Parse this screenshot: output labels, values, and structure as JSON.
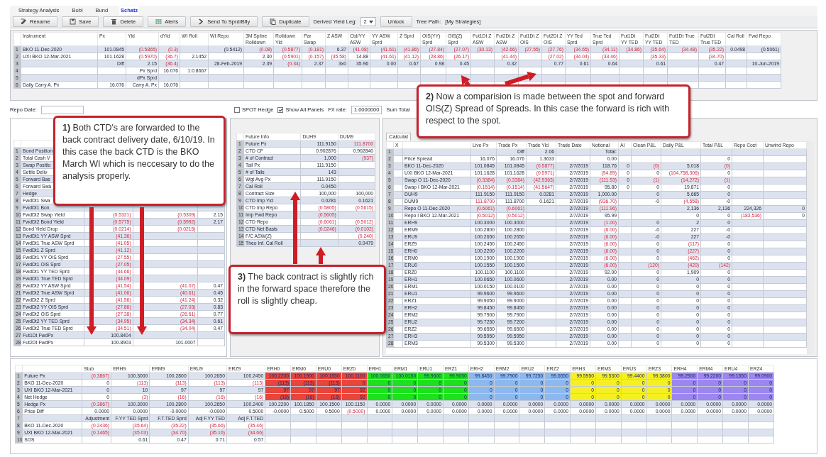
{
  "tabs": [
    {
      "label": "Strategy Analysis",
      "selected": false
    },
    {
      "label": "Bobl",
      "selected": false
    },
    {
      "label": "Bund",
      "selected": false
    },
    {
      "label": "Schatz",
      "selected": true
    }
  ],
  "toolbar": {
    "buttons": [
      "Rename",
      "Save",
      "Delete",
      "Alerts",
      "Send To Sprd/Bfly",
      "Duplicate"
    ],
    "derived_yield_leg": {
      "label": "Derived Yield Leg:",
      "value": "2"
    },
    "unlock": "Unlock",
    "tree_path": {
      "label": "Tree Path:",
      "value": "[My Strategies]"
    }
  },
  "top_table": {
    "columns": [
      "Instrument",
      "Px",
      "Yld",
      "dYld",
      "WI Roll",
      "WI Repo",
      "3M Spline Rolldown",
      "Rolldown Yld",
      "Par Swap",
      "Z ASW",
      "Ctd/YY ASW",
      "YY ASW Sprd",
      "Z Sprd",
      "OIS(YY) Sprd",
      "OIS(Z) Sprd",
      "Fut1Dt Z ASW",
      "Fut2Dt Z ASW",
      "Fut1Dt Z OIS",
      "Fut2Dt Z OIS",
      "YY Ted Sprd",
      "True Ted Sprd",
      "Fut1Dt YY TED",
      "Fut2Dt YY TED",
      "Fut1Dt True TED",
      "Fut2Dt True TED",
      "Cal Roll",
      "Fwd Repo"
    ],
    "rows": [
      {
        "n": "1",
        "cells": [
          {
            "text": "BKO 11-Dec-2020",
            "kind": "cyan"
          },
          {
            "text": "101.0845",
            "kind": "cyan"
          },
          {
            "text": "(0.5865)",
            "kind": "neg"
          },
          {
            "text": "(0.3)",
            "kind": "neg"
          },
          null,
          {
            "text": "(0.5412)",
            "kind": "cyan"
          },
          {
            "text": "(0.08)",
            "kind": "neg"
          },
          {
            "text": "(0.5877)",
            "kind": "neg"
          },
          {
            "text": "(0.181)",
            "kind": "neg"
          },
          "6.37",
          {
            "text": "(41.08)",
            "kind": "neg"
          },
          {
            "text": "(41.61)",
            "kind": "neg"
          },
          {
            "text": "(41.86)",
            "kind": "neg"
          },
          {
            "text": "(27.84)",
            "kind": "neg"
          },
          {
            "text": "(27.07)",
            "kind": "neg"
          },
          {
            "text": "(30.13)",
            "kind": "neg"
          },
          {
            "text": "(42.66)",
            "kind": "neg"
          },
          {
            "text": "(27.55)",
            "kind": "neg"
          },
          {
            "text": "(27.76)",
            "kind": "neg"
          },
          {
            "text": "(34.65)",
            "kind": "neg"
          },
          {
            "text": "(34.11)",
            "kind": "neg"
          },
          {
            "text": "(34.86)",
            "kind": "neg"
          },
          {
            "text": "(35.64)",
            "kind": "neg"
          },
          {
            "text": "(34.48)",
            "kind": "neg"
          },
          {
            "text": "(35.22)",
            "kind": "neg"
          },
          {
            "text": "0.0498",
            "kind": "cyan"
          },
          {
            "text": "(0.5061)",
            "kind": "cyan"
          }
        ]
      },
      {
        "n": "2",
        "cells": [
          {
            "text": "UXI BKO 12-Mar-2021",
            "kind": "cyan"
          },
          {
            "text": "101.1628",
            "kind": "cyan"
          },
          {
            "text": "(0.5970)",
            "kind": "neg"
          },
          {
            "text": "(36.7)",
            "kind": "neg"
          },
          {
            "text": "2.1452",
            "kind": "cyan"
          },
          null,
          "2.30",
          {
            "text": "(0.5901)",
            "kind": "neg"
          },
          {
            "text": "(0.157)",
            "kind": "neg"
          },
          {
            "text": "(35.58)",
            "kind": "neg"
          },
          "14.88",
          {
            "text": "(41.61)",
            "kind": "neg"
          },
          {
            "text": "(41.12)",
            "kind": "neg"
          },
          {
            "text": "(28.86)",
            "kind": "neg"
          },
          {
            "text": "(26.17)",
            "kind": "neg"
          },
          null,
          {
            "text": "(41.44)",
            "kind": "neg"
          },
          null,
          {
            "text": "(27.02)",
            "kind": "neg"
          },
          {
            "text": "(34.04)",
            "kind": "neg"
          },
          {
            "text": "(33.46)",
            "kind": "neg"
          },
          null,
          {
            "text": "(35.33)",
            "kind": "neg"
          },
          null,
          {
            "text": "(34.70)",
            "kind": "neg"
          }
        ]
      },
      {
        "n": "3",
        "cells": [
          null,
          "Diff",
          {
            "text": "2.15",
            "kind": "cyan"
          },
          {
            "text": "(36.4)",
            "kind": "neg"
          },
          null,
          "28-Feb-2019",
          "2.39",
          {
            "text": "(0.34)",
            "kind": "neg"
          },
          "2.37",
          "3x0",
          {
            "text": "35.96",
            "kind": "yellow"
          },
          {
            "text": "0.00",
            "kind": "yellow"
          },
          {
            "text": "0.67",
            "kind": "yellow"
          },
          {
            "text": "0.98",
            "kind": "yellow"
          },
          {
            "text": "0.45",
            "kind": "yellow"
          },
          null,
          {
            "text": "0.32",
            "kind": "yellow"
          },
          null,
          {
            "text": "0.77",
            "kind": "yellow"
          },
          {
            "text": "0.61",
            "kind": "yellow"
          },
          {
            "text": "0.64",
            "kind": "yellow"
          },
          null,
          {
            "text": "0.61",
            "kind": "yellow"
          },
          null,
          {
            "text": "0.47",
            "kind": "yellow"
          },
          null,
          "10-Jun-2019"
        ]
      },
      {
        "n": "4",
        "cells": [
          null,
          null,
          "Px Sprd",
          "16.076",
          {
            "text": "1:0.8667",
            "kind": "cyan"
          }
        ]
      },
      {
        "n": "5",
        "cells": [
          null,
          null,
          "dPx Sprd"
        ]
      },
      {
        "n": "6",
        "cells": [
          "Daily Carry A. Px",
          "16.076",
          "Carry A. Px",
          "16.076"
        ]
      }
    ]
  },
  "controls": {
    "repo_date_label": "Repo Date:",
    "spot_hedge": {
      "label": "SPOT Hedge",
      "checked": false
    },
    "show_all_panels": {
      "label": "Show All Panels",
      "checked": true
    },
    "fx_rate": {
      "label": "FX rate:",
      "value": "1.0000000"
    },
    "sum_total": "Sum Total"
  },
  "position_table": {
    "rows": [
      {
        "n": "1",
        "cells": [
          "Bond Position"
        ]
      },
      {
        "n": "2",
        "cells": [
          "Total Cash V"
        ]
      },
      {
        "n": "3",
        "cells": [
          "Swap Positio"
        ]
      },
      {
        "n": "4",
        "cells": [
          "Settle Deliv"
        ]
      },
      {
        "n": "5",
        "cells": [
          "Forward Bas"
        ]
      },
      {
        "n": "6",
        "cells": [
          "Forward Swa"
        ]
      },
      {
        "n": "7",
        "cells": [
          "Hedge"
        ]
      },
      {
        "n": "8",
        "cells": [
          "FwdDt1 Swa"
        ]
      },
      {
        "n": "9",
        "cells": [
          "FwdDt1 Bon"
        ]
      },
      {
        "n": "10",
        "cells": [
          "FwdDt2 Swap Yield",
          {
            "text": "(0.5321)",
            "kind": "neg"
          },
          {
            "text": "(0.5309)",
            "kind": "neg"
          },
          "2.15"
        ]
      },
      {
        "n": "11",
        "cells": [
          "FwdDt2 Bond Yield",
          {
            "text": "(0.5775)",
            "kind": "neg"
          },
          {
            "text": "(0.5992)",
            "kind": "neg"
          },
          "2.17"
        ]
      },
      {
        "n": "12",
        "cells": [
          "Bond Yield Drop",
          {
            "text": "(0.0214)",
            "kind": "neg"
          },
          {
            "text": "(0.0215)",
            "kind": "neg"
          }
        ]
      },
      {
        "n": "13",
        "cells": [
          "FwdDt1 YY ASW Sprd",
          {
            "text": "(41.36)",
            "kind": "neg"
          }
        ]
      },
      {
        "n": "14",
        "cells": [
          "FwdDt1 True ASW Sprd",
          {
            "text": "(41.05)",
            "kind": "neg"
          }
        ]
      },
      {
        "n": "15",
        "cells": [
          "FwdDt1 Z Sprd",
          {
            "text": "(41.12)",
            "kind": "neg"
          }
        ]
      },
      {
        "n": "16",
        "cells": [
          "FwdDt1 YY OIS Sprd",
          {
            "text": "(27.55)",
            "kind": "neg"
          }
        ]
      },
      {
        "n": "17",
        "cells": [
          "FwdDt1 OIS Sprd",
          {
            "text": "(27.05)",
            "kind": "neg"
          }
        ]
      },
      {
        "n": "18",
        "cells": [
          "FwdDt1 YY TED Sprd",
          {
            "text": "(34.66)",
            "kind": "neg"
          }
        ]
      },
      {
        "n": "19",
        "cells": [
          "FwdDt1 True TED Sprd",
          {
            "text": "(34.09)",
            "kind": "neg"
          }
        ]
      },
      {
        "n": "20",
        "cells": [
          "FwdDt2 YY ASW Sprd",
          {
            "text": "(41.54)",
            "kind": "neg"
          },
          {
            "text": "(41.07)",
            "kind": "neg"
          },
          {
            "text": "0.47",
            "kind": "yellow"
          }
        ]
      },
      {
        "n": "21",
        "cells": [
          "FwdDt2 True ASW Sprd",
          {
            "text": "(41.06)",
            "kind": "neg"
          },
          {
            "text": "(40.61)",
            "kind": "neg"
          },
          {
            "text": "0.45",
            "kind": "yellow"
          }
        ]
      },
      {
        "n": "22",
        "cells": [
          "FwdDt2 Z Sprd",
          {
            "text": "(41.56)",
            "kind": "neg"
          },
          {
            "text": "(41.24)",
            "kind": "neg"
          },
          {
            "text": "0.32",
            "kind": "yellow"
          }
        ]
      },
      {
        "n": "23",
        "cells": [
          "FwdDt2 YY OIS Sprd",
          {
            "text": "(27.86)",
            "kind": "neg"
          },
          {
            "text": "(27.03)",
            "kind": "neg"
          },
          {
            "text": "0.83",
            "kind": "yellow"
          }
        ]
      },
      {
        "n": "24",
        "cells": [
          "FwdDt2 OIS Sprd",
          {
            "text": "(27.38)",
            "kind": "neg"
          },
          {
            "text": "(26.61)",
            "kind": "neg"
          },
          {
            "text": "0.77",
            "kind": "yellow"
          }
        ]
      },
      {
        "n": "25",
        "cells": [
          "FwdDt2 YY TED Sprd",
          {
            "text": "(34.95)",
            "kind": "neg"
          },
          {
            "text": "(34.34)",
            "kind": "neg"
          },
          {
            "text": "0.61",
            "kind": "yellow"
          }
        ]
      },
      {
        "n": "26",
        "cells": [
          "FwdDt2 True TED Sprd",
          {
            "text": "(34.51)",
            "kind": "neg"
          },
          {
            "text": "(34.04)",
            "kind": "neg"
          },
          {
            "text": "0.47",
            "kind": "yellow"
          }
        ]
      },
      {
        "n": "27",
        "cells": [
          "Fut1Dt FwdPx",
          "100.8404"
        ]
      },
      {
        "n": "28",
        "cells": [
          "Fut2Dt FwdPx",
          "100.8903",
          "101.0007"
        ]
      }
    ]
  },
  "future_info": {
    "columns": [
      "Future Info",
      "DUH9",
      "DUM9"
    ],
    "rows": [
      {
        "n": "1",
        "cells": [
          "Future Px",
          {
            "text": "111.9150",
            "kind": "cyan"
          },
          {
            "text": "111.8700",
            "kind": "pinkneg"
          }
        ]
      },
      {
        "n": "2",
        "cells": [
          "CTD CF",
          "0.902876",
          "0.902840"
        ]
      },
      {
        "n": "3",
        "cells": [
          "# of Contract",
          {
            "text": "1,000",
            "kind": "cyan"
          },
          {
            "text": "(937)",
            "kind": "cyanneg"
          }
        ]
      },
      {
        "n": "4",
        "cells": [
          "Tail Px",
          {
            "text": "111.9150",
            "kind": "cyan"
          }
        ]
      },
      {
        "n": "5",
        "cells": [
          "# of Tails",
          "143"
        ]
      },
      {
        "n": "6",
        "cells": [
          "Wgt Avg Px",
          {
            "text": "111.9150",
            "kind": "cyan"
          }
        ]
      },
      {
        "n": "7",
        "cells": [
          "Cal Roll",
          {
            "text": "0.0450",
            "kind": "cyan"
          }
        ]
      },
      {
        "n": "8",
        "cells": [
          "Contract Size",
          "100,000",
          "100,000"
        ]
      },
      {
        "n": "9",
        "cells": [
          "CTD Imp Yld",
          {
            "text": "0.0281",
            "kind": "cyan"
          },
          {
            "text": "0.1621",
            "kind": "cyan"
          }
        ]
      },
      {
        "n": "10",
        "cells": [
          "CTD Imp Repo",
          {
            "text": "(0.5805)",
            "kind": "neg"
          },
          {
            "text": "(0.5615)",
            "kind": "neg"
          }
        ]
      },
      {
        "n": "11",
        "cells": [
          "Imp Fwd Repo",
          {
            "text": "(0.5605)",
            "kind": "neg"
          }
        ]
      },
      {
        "n": "12",
        "cells": [
          "CTD Repo",
          {
            "text": "(0.6061)",
            "kind": "cyanneg"
          },
          {
            "text": "(0.5012)",
            "kind": "cyanneg"
          }
        ]
      },
      {
        "n": "13",
        "cells": [
          "CTD Net Basis",
          {
            "text": "(0.0246)",
            "kind": "cyanneg"
          },
          {
            "text": "(0.0102)",
            "kind": "cyanneg"
          }
        ]
      },
      {
        "n": "14",
        "cells": [
          "F/C ASW(Z)",
          null,
          {
            "text": "(0.240)",
            "kind": "neg"
          }
        ]
      },
      {
        "n": "15",
        "cells": [
          "Theo Inf. Cal Roll",
          null,
          {
            "text": "0.0479",
            "kind": "cyan"
          }
        ]
      }
    ]
  },
  "calculator": {
    "tab": "Calculat",
    "columns": [
      "X",
      null,
      "Live Px",
      "Trade Px",
      "Trade Yld",
      "Trade Date",
      "Notional",
      "AI",
      "Clean P&L",
      "Daily P&L",
      "Total P&L",
      "Repo Cost",
      "Unwind Repo"
    ],
    "rows": [
      {
        "n": "1",
        "cells": [
          {
            "kind": "cyan"
          },
          null,
          null,
          {
            "text": "Diff",
            "kind": "cyan"
          },
          "2.06",
          null,
          {
            "text": "Total:",
            "kind": "cyan"
          }
        ]
      },
      {
        "n": "2",
        "cells": [
          {
            "kind": "cyan"
          },
          "Price Spread",
          "16.076",
          {
            "text": "16.076",
            "kind": "cyan"
          },
          "1.3633",
          null,
          {
            "text": "0.00",
            "kind": "cyan"
          },
          null,
          null,
          null,
          "0"
        ]
      },
      {
        "n": "3",
        "cells": [
          {
            "kind": "cyan"
          },
          "BKO 11-Dec-2020",
          "101.0845",
          {
            "text": "101.0845",
            "kind": "pink"
          },
          {
            "text": "(0.5877)",
            "kind": "pinkneg"
          },
          {
            "text": "2/7/2019",
            "kind": "cyan"
          },
          {
            "text": "118.76",
            "kind": "cyan"
          },
          "0",
          {
            "text": "(0)",
            "kind": "neg"
          },
          "5,018",
          {
            "text": "(0)",
            "kind": "neg"
          }
        ]
      },
      {
        "n": "4",
        "cells": [
          {
            "kind": "cyan"
          },
          "UXI BKO 12-Mar-2021",
          "101.1628",
          {
            "text": "101.1628",
            "kind": "pink"
          },
          {
            "text": "(0.5971)",
            "kind": "pinkneg"
          },
          {
            "text": "2/7/2019",
            "kind": "cyan"
          },
          {
            "text": "(94.89)",
            "kind": "cyanneg"
          },
          "0",
          "0",
          {
            "text": "(104,758,306)",
            "kind": "neg"
          },
          "0"
        ]
      },
      {
        "n": "5",
        "cells": [
          {
            "kind": "cyan"
          },
          "Swap O 11-Dec-2020",
          {
            "text": "(0.3384)",
            "kind": "neg"
          },
          {
            "text": "(0.3384)",
            "kind": "cyanneg"
          },
          {
            "text": "(42.9363)",
            "kind": "neg"
          },
          {
            "text": "2/7/2019",
            "kind": "cyan"
          },
          {
            "text": "(111.93)",
            "kind": "cyanneg"
          },
          "0",
          {
            "text": "(1)",
            "kind": "neg"
          },
          {
            "text": "(14,272)",
            "kind": "neg"
          },
          {
            "text": "(1)",
            "kind": "neg"
          }
        ]
      },
      {
        "n": "6",
        "cells": [
          {
            "kind": "cyan"
          },
          "Swap I BKO 12-Mar-2021",
          {
            "text": "(0.1514)",
            "kind": "neg"
          },
          {
            "text": "(0.1514)",
            "kind": "cyanneg"
          },
          {
            "text": "(41.5647)",
            "kind": "neg"
          },
          {
            "text": "2/7/2019",
            "kind": "cyan"
          },
          {
            "text": "95.80",
            "kind": "cyan"
          },
          "0",
          "0",
          "19,871",
          "0"
        ]
      },
      {
        "n": "7",
        "cells": [
          {
            "kind": "cyan"
          },
          "DUH9",
          "111.9150",
          {
            "text": "111.9150",
            "kind": "pink"
          },
          "0.0281",
          {
            "text": "2/7/2019",
            "kind": "cyan"
          },
          {
            "text": "1,000.00",
            "kind": "cyan"
          },
          null,
          "0",
          "5,665",
          "0"
        ]
      },
      {
        "n": "8",
        "cells": [
          {
            "kind": "cyan"
          },
          "DUM9",
          {
            "text": "111.8700",
            "kind": "pinkneg"
          },
          {
            "text": "111.8700",
            "kind": "pink"
          },
          "0.1621",
          {
            "text": "2/7/2019",
            "kind": "cyan"
          },
          {
            "text": "(936.70)",
            "kind": "cyanneg"
          },
          null,
          "-0",
          {
            "text": "(4,558)",
            "kind": "neg"
          },
          "-0"
        ]
      },
      {
        "n": "9",
        "cells": [
          {
            "kind": "cyan"
          },
          "Repo O 11-Dec-2020",
          {
            "text": "(0.6061)",
            "kind": "neg"
          },
          {
            "text": "(0.6061)",
            "kind": "cyanneg"
          },
          null,
          {
            "text": "2/7/2019",
            "kind": "cyan"
          },
          {
            "text": "(111.96)",
            "kind": "cyanneg"
          },
          null,
          null,
          "2,136",
          "2,136",
          "224,326",
          "0"
        ]
      },
      {
        "n": "10",
        "cells": [
          {
            "kind": "cyan"
          },
          "Repo I BKO 12-Mar-2021",
          {
            "text": "(0.5012)",
            "kind": "neg"
          },
          {
            "text": "(0.5012)",
            "kind": "cyanneg"
          },
          null,
          {
            "text": "2/7/2019",
            "kind": "cyan"
          },
          {
            "text": "95.99",
            "kind": "cyan"
          },
          null,
          null,
          "0",
          "0",
          {
            "text": "(183,536)",
            "kind": "neg"
          },
          "0"
        ]
      },
      {
        "n": "11",
        "cells": [
          {
            "kind": "cyan"
          },
          "ERH9",
          "100.3000",
          {
            "text": "100.3000",
            "kind": "pink"
          },
          null,
          {
            "text": "2/7/2019",
            "kind": "cyan"
          },
          {
            "text": "(1.00)",
            "kind": "cyanneg"
          },
          null,
          "0",
          "2",
          "0"
        ]
      },
      {
        "n": "12",
        "cells": [
          {
            "kind": "cyan"
          },
          "ERM9",
          "100.2800",
          {
            "text": "100.2800",
            "kind": "pink"
          },
          null,
          {
            "text": "2/7/2019",
            "kind": "cyan"
          },
          {
            "text": "(6.00)",
            "kind": "cyanneg"
          },
          null,
          "-0",
          "227",
          "-0"
        ]
      },
      {
        "n": "13",
        "cells": [
          {
            "kind": "cyan"
          },
          "ERU9",
          "100.2650",
          {
            "text": "100.2650",
            "kind": "pink"
          },
          null,
          {
            "text": "2/7/2019",
            "kind": "cyan"
          },
          {
            "text": "(6.00)",
            "kind": "cyanneg"
          },
          null,
          "-0",
          "227",
          "-0"
        ]
      },
      {
        "n": "14",
        "cells": [
          {
            "kind": "cyan"
          },
          "ERZ9",
          "100.2450",
          {
            "text": "100.2450",
            "kind": "pink"
          },
          null,
          {
            "text": "2/7/2019",
            "kind": "cyan"
          },
          {
            "text": "(6.00)",
            "kind": "cyanneg"
          },
          null,
          "0",
          {
            "text": "(117)",
            "kind": "neg"
          },
          "0"
        ]
      },
      {
        "n": "15",
        "cells": [
          {
            "kind": "cyan"
          },
          "ERH0",
          "100.2200",
          {
            "text": "100.2200",
            "kind": "pink"
          },
          null,
          {
            "text": "2/7/2019",
            "kind": "cyan"
          },
          {
            "text": "(6.00)",
            "kind": "cyanneg"
          },
          null,
          "0",
          {
            "text": "(227)",
            "kind": "neg"
          },
          "0"
        ]
      },
      {
        "n": "16",
        "cells": [
          {
            "kind": "cyan"
          },
          "ERM0",
          "100.1900",
          {
            "text": "100.1900",
            "kind": "pink"
          },
          null,
          {
            "text": "2/7/2019",
            "kind": "cyan"
          },
          {
            "text": "(6.00)",
            "kind": "cyanneg"
          },
          null,
          "0",
          {
            "text": "(462)",
            "kind": "neg"
          },
          "0"
        ]
      },
      {
        "n": "17",
        "cells": [
          {
            "kind": "cyan"
          },
          "ERU0",
          "100.1550",
          {
            "text": "100.1500",
            "kind": "pink"
          },
          null,
          {
            "text": "2/7/2019",
            "kind": "cyan"
          },
          {
            "text": "(6.00)",
            "kind": "cyanneg"
          },
          null,
          {
            "text": "(120)",
            "kind": "neg"
          },
          {
            "text": "(420)",
            "kind": "neg"
          },
          {
            "text": "(142)",
            "kind": "neg"
          }
        ]
      },
      {
        "n": "18",
        "cells": [
          {
            "kind": "cyan"
          },
          "ERZ0",
          "100.1100",
          {
            "text": "100.1100",
            "kind": "pink"
          },
          null,
          {
            "text": "2/7/2019",
            "kind": "cyan"
          },
          {
            "text": "92.00",
            "kind": "cyan"
          },
          null,
          "0",
          "1,909",
          "0"
        ]
      },
      {
        "n": "19",
        "cells": [
          {
            "kind": "cyan"
          },
          "ERH1",
          "100.0650",
          {
            "text": "100.0600",
            "kind": "pink"
          },
          null,
          {
            "text": "2/7/2019",
            "kind": "cyan"
          },
          {
            "text": "0.00",
            "kind": "cyan"
          },
          null,
          "0",
          "0",
          "0"
        ]
      },
      {
        "n": "20",
        "cells": [
          {
            "kind": "cyan"
          },
          "ERM1",
          "100.0150",
          {
            "text": "100.0100",
            "kind": "pink"
          },
          null,
          {
            "text": "2/7/2019",
            "kind": "cyan"
          },
          {
            "text": "0.00",
            "kind": "cyan"
          },
          null,
          "0",
          "0",
          "0"
        ]
      },
      {
        "n": "21",
        "cells": [
          {
            "kind": "cyan"
          },
          "ERU1",
          "99.9600",
          {
            "text": "99.9600",
            "kind": "pink"
          },
          null,
          {
            "text": "2/7/2019",
            "kind": "cyan"
          },
          {
            "text": "0.00",
            "kind": "cyan"
          },
          null,
          "0",
          "0",
          "0"
        ]
      },
      {
        "n": "22",
        "cells": [
          {
            "kind": "cyan"
          },
          "ERZ1",
          "99.9050",
          {
            "text": "99.9000",
            "kind": "pink"
          },
          null,
          {
            "text": "2/7/2019",
            "kind": "cyan"
          },
          {
            "text": "0.00",
            "kind": "cyan"
          },
          null,
          "0",
          "0",
          "0"
        ]
      },
      {
        "n": "23",
        "cells": [
          {
            "kind": "cyan"
          },
          "ERH2",
          "99.8450",
          {
            "text": "99.8450",
            "kind": "pink"
          },
          null,
          {
            "text": "2/7/2019",
            "kind": "cyan"
          },
          {
            "text": "0.00",
            "kind": "cyan"
          },
          null,
          "0",
          "0",
          "0"
        ]
      },
      {
        "n": "24",
        "cells": [
          {
            "kind": "cyan"
          },
          "ERM2",
          "99.7900",
          {
            "text": "99.7900",
            "kind": "pink"
          },
          null,
          {
            "text": "2/7/2019",
            "kind": "cyan"
          },
          {
            "text": "0.00",
            "kind": "cyan"
          },
          null,
          "0",
          "0",
          "0"
        ]
      },
      {
        "n": "25",
        "cells": [
          {
            "kind": "cyan"
          },
          "ERU2",
          "99.7250",
          {
            "text": "99.7200",
            "kind": "pink"
          },
          null,
          {
            "text": "2/7/2019",
            "kind": "cyan"
          },
          {
            "text": "0.00",
            "kind": "cyan"
          },
          null,
          "0",
          "0",
          "0"
        ]
      },
      {
        "n": "26",
        "cells": [
          {
            "kind": "cyan"
          },
          "ERZ2",
          "99.6550",
          {
            "text": "99.6500",
            "kind": "pink"
          },
          null,
          {
            "text": "2/7/2019",
            "kind": "cyan"
          },
          {
            "text": "0.00",
            "kind": "cyan"
          },
          null,
          "0",
          "0",
          "0"
        ]
      },
      {
        "n": "27",
        "cells": [
          {
            "kind": "cyan"
          },
          "ERH3",
          "99.5950",
          {
            "text": "99.5950",
            "kind": "pink"
          },
          null,
          {
            "text": "2/7/2019",
            "kind": "cyan"
          },
          {
            "text": "0.00",
            "kind": "cyan"
          },
          null,
          "0",
          "0",
          "0"
        ]
      },
      {
        "n": "28",
        "cells": [
          {
            "kind": "cyan"
          },
          "ERM3",
          "99.5300",
          {
            "text": "99.5300",
            "kind": "pink"
          },
          null,
          {
            "text": "2/7/2019",
            "kind": "cyan"
          },
          {
            "text": "0.00",
            "kind": "cyan"
          },
          null,
          "0",
          "0",
          "0"
        ]
      }
    ]
  },
  "hedge_table": {
    "columns": [
      {
        "label": "Stub"
      },
      {
        "label": "ERH9"
      },
      {
        "label": "ERM9"
      },
      {
        "label": "ERU9"
      },
      {
        "label": "ERZ9"
      },
      {
        "label": "ERH0",
        "color": "#e8453c"
      },
      {
        "label": "ERM0",
        "color": "#e8453c"
      },
      {
        "label": "ERU0",
        "color": "#e8453c"
      },
      {
        "label": "ERZ0",
        "color": "#e8453c"
      },
      {
        "label": "ERH1",
        "color": "#1fe01f"
      },
      {
        "label": "ERM1",
        "color": "#1fe01f"
      },
      {
        "label": "ERU1",
        "color": "#1fe01f"
      },
      {
        "label": "ERZ1",
        "color": "#1fe01f"
      },
      {
        "label": "ERH2",
        "color": "#8db8ee"
      },
      {
        "label": "ERM2",
        "color": "#8db8ee"
      },
      {
        "label": "ERU2",
        "color": "#8db8ee"
      },
      {
        "label": "ERZ2",
        "color": "#8db8ee"
      },
      {
        "label": "ERH3",
        "color": "#f5f026"
      },
      {
        "label": "ERM3",
        "color": "#f5f026"
      },
      {
        "label": "ERU3",
        "color": "#f5f026"
      },
      {
        "label": "ERZ3",
        "color": "#f5f026"
      },
      {
        "label": "ERH4",
        "color": "#9c86f0"
      },
      {
        "label": "ERM4",
        "color": "#9c86f0"
      },
      {
        "label": "ERU4",
        "color": "#9c86f0"
      },
      {
        "label": "ERZ4",
        "color": "#9c86f0"
      }
    ],
    "rows": [
      {
        "n": "1",
        "label": "Future Px",
        "kind": "group",
        "cells": [
          {
            "text": "(0.3867)",
            "kind": "neg"
          },
          "100.3000",
          "100.2800",
          "100.2650",
          "100.2450",
          "100.2200",
          "100.1900",
          "100.1550",
          "100.1100",
          "100.0650",
          "100.0150",
          "99.9600",
          "99.9050",
          "99.8450",
          "99.7900",
          "99.7250",
          "99.6550",
          "99.5950",
          "99.5300",
          "99.4400",
          "99.3800",
          "99.2900",
          "99.2200",
          "99.1550",
          "99.0900"
        ]
      },
      {
        "n": "2",
        "label": "BKO 11-Dec-2020",
        "kind": "group",
        "cells": [
          "0",
          {
            "text": "(113)",
            "kind": "neg"
          },
          {
            "text": "(113)",
            "kind": "neg"
          },
          {
            "text": "(113)",
            "kind": "neg"
          },
          {
            "text": "(113)",
            "kind": "neg"
          },
          "(113)",
          "(113)",
          "(113)",
          "0",
          "0",
          "0",
          "0",
          "0",
          "0",
          "0",
          "0",
          "0",
          "0",
          "0",
          "0",
          "0",
          "0",
          "0",
          "0",
          "0"
        ]
      },
      {
        "n": "3",
        "label": "UXI BKO 12-Mar-2021",
        "kind": "group",
        "cells": [
          "0",
          "10",
          "97",
          "97",
          "97",
          "97",
          "97",
          "97",
          "92",
          "0",
          "0",
          "0",
          "0",
          "0",
          "0",
          "0",
          "0",
          "0",
          "0",
          "0",
          "0",
          "0",
          "0",
          "0",
          "0"
        ]
      },
      {
        "n": "4",
        "label": "Net Hedge",
        "kind": "group",
        "cells": [
          "0",
          {
            "text": "(3)",
            "kind": "neg"
          },
          {
            "text": "(16)",
            "kind": "neg"
          },
          {
            "text": "(16)",
            "kind": "neg"
          },
          {
            "text": "(16)",
            "kind": "neg"
          },
          "(16)",
          "(16)",
          "(16)",
          "92",
          "0",
          "0",
          "0",
          "0",
          "0",
          "0",
          "0",
          "0",
          "0",
          "0",
          "0",
          "0",
          "0",
          "0",
          "0",
          "0"
        ]
      },
      {
        "n": "5",
        "label": "Hedge Px",
        "kind": "cyan",
        "cells": [
          {
            "text": "(0.3867)",
            "kind": "neg"
          },
          "100.3000",
          "100.2800",
          "100.2650",
          "100.2400",
          "100.2200",
          "100.1850",
          "100.1500",
          "100.1150",
          "0.0000",
          "0.0000",
          "0.0000",
          "0.0000",
          "0.0000",
          "0.0000",
          "0.0000",
          "0.0000",
          "0.0000",
          "0.0000",
          "0.0000",
          "0.0000",
          "0.0000",
          "0.0000",
          "0.0000",
          "0.0000"
        ]
      },
      {
        "n": "6",
        "label": "Price Diff",
        "kind": "plain",
        "cells": [
          "0.0000",
          "0.0000",
          "-0.0000",
          "-0.0000",
          "0.5000",
          "-0.0000",
          "0.5000",
          "0.5000",
          {
            "text": "(0.5000)",
            "kind": "neg"
          },
          "0.0000",
          "0.0000",
          "0.0000",
          "0.0000",
          "0.0000",
          "0.0000",
          "0.0000",
          "0.0000",
          "0.0000",
          "0.0000",
          "0.0000",
          "0.0000",
          "0.0000",
          "0.0000",
          "0.0000",
          "0.0000"
        ]
      },
      {
        "n": "7",
        "kind": "plain",
        "cells": [
          "Adjustment",
          "F.YY TED Sprd",
          "F.T.TED Sprd",
          "Adj F.YY TED",
          "Adj F.T.TED"
        ]
      },
      {
        "n": "8",
        "label": "BKO 11-Dec-2020",
        "kind": "plain",
        "cells": [
          {
            "text": "(0.2436)",
            "kind": "neg"
          },
          {
            "text": "(35.64)",
            "kind": "neg"
          },
          {
            "text": "(35.22)",
            "kind": "neg"
          },
          {
            "text": "(35.66)",
            "kind": "neg"
          },
          {
            "text": "(35.46)",
            "kind": "neg"
          }
        ]
      },
      {
        "n": "9",
        "label": "UXI BKO 12-Mar-2021",
        "kind": "plain",
        "cells": [
          {
            "text": "(0.1465)",
            "kind": "neg"
          },
          {
            "text": "(35.03)",
            "kind": "neg"
          },
          {
            "text": "(34.70)",
            "kind": "neg"
          },
          {
            "text": "(35.16)",
            "kind": "neg"
          },
          {
            "text": "(34.66)",
            "kind": "neg"
          }
        ]
      },
      {
        "n": "10",
        "label": "SOS",
        "kind": "plain",
        "cells": [
          null,
          "0.61",
          "0.47",
          "0.71",
          "0.57"
        ]
      }
    ]
  },
  "callouts": [
    {
      "text": "**1)** Both CTD's are forwarded to the back contract delivery date, 6/10/19. In this case the back CTD is the BKO March WI which is neccesary to do the analysis properly."
    },
    {
      "text": "**2)** Now a comparision is made between the spot and forward OIS(Z) Spread of Spreads. In this case the forward is rich with respect to the spot."
    },
    {
      "text": "**3)** The back contract is slightly rich in the forward space therefore the roll is slightly cheap."
    }
  ]
}
